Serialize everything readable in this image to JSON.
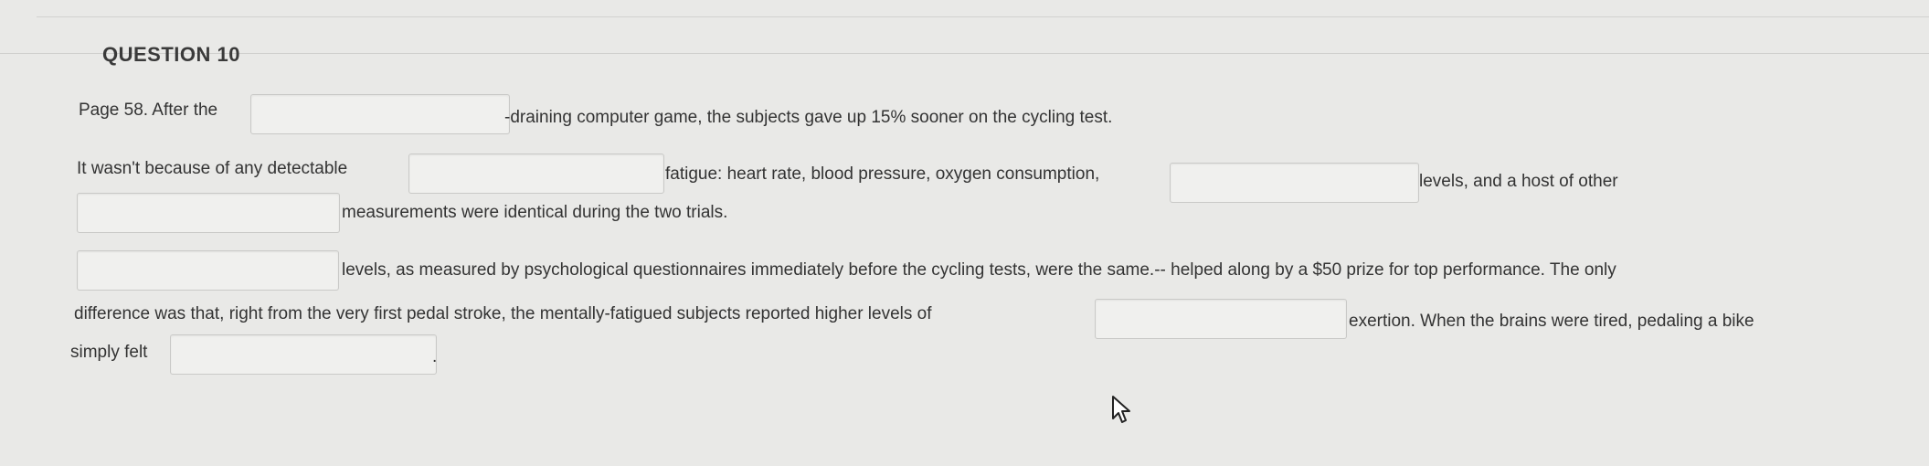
{
  "question": {
    "title": "QUESTION 10"
  },
  "text": {
    "l1a": "Page 58. After the",
    "l1b": "-draining computer game, the subjects gave up 15% sooner on the cycling test.",
    "l2a": "It wasn't because of any detectable",
    "l2b": "fatigue: heart rate, blood pressure, oxygen consumption,",
    "l2c": "levels,  and a host of other",
    "l3a": "measurements were identical during the two trials.",
    "l4a": "levels, as measured by psychological questionnaires immediately before the cycling tests, were the same.-- helped along by a $50 prize for top performance. The only",
    "l5a": "difference was that, right from the very first pedal stroke, the mentally-fatigued subjects reported higher levels of",
    "l5b": "exertion. When the brains were tired, pedaling a bike",
    "l6a": "simply felt",
    "l6b": "."
  },
  "blanks": [
    "",
    "",
    "",
    "",
    "",
    "",
    ""
  ]
}
